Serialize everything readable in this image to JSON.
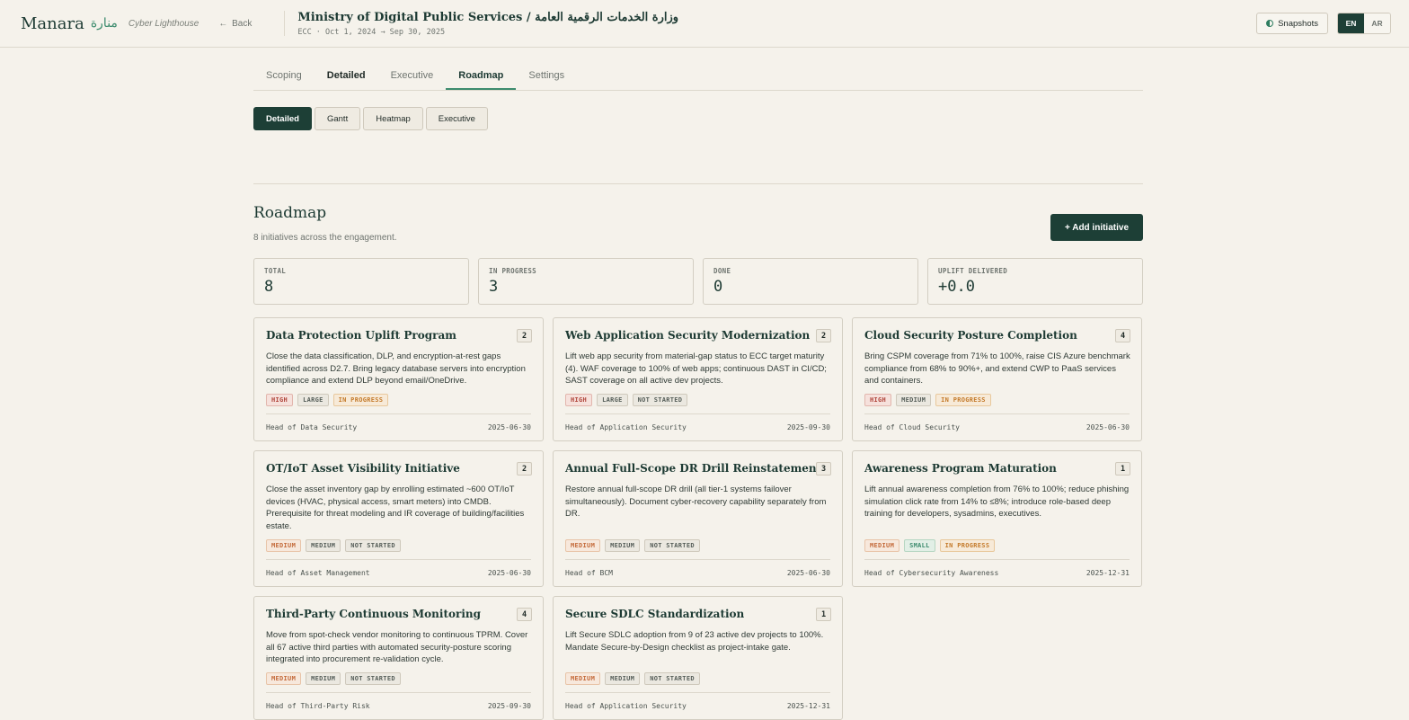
{
  "header": {
    "brand": "Manara",
    "brand_ar": "منارة",
    "tagline": "Cyber Lighthouse",
    "back_label": "Back",
    "ministry_title": "Ministry of Digital Public Services / وزارة الخدمات الرقمية العامة",
    "ministry_sub": "ECC · Oct 1, 2024 → Sep 30, 2025",
    "snapshots_label": "Snapshots",
    "lang_en": "EN",
    "lang_ar": "AR"
  },
  "tabs": [
    "Scoping",
    "Detailed",
    "Executive",
    "Roadmap",
    "Settings"
  ],
  "subtabs": [
    "Detailed",
    "Gantt",
    "Heatmap",
    "Executive"
  ],
  "roadmap": {
    "title": "Roadmap",
    "subtitle": "8 initiatives across the engagement.",
    "add_label": "+ Add initiative"
  },
  "stats": [
    {
      "label": "TOTAL",
      "value": "8"
    },
    {
      "label": "IN PROGRESS",
      "value": "3"
    },
    {
      "label": "DONE",
      "value": "0"
    },
    {
      "label": "UPLIFT DELIVERED",
      "value": "+0.0"
    }
  ],
  "cards": [
    {
      "title": "Data Protection Uplift Program",
      "count": "2",
      "desc": "Close the data classification, DLP, and encryption-at-rest gaps identified across D2.7. Bring legacy database servers into encryption compliance and extend DLP beyond email/OneDrive.",
      "priority": "HIGH",
      "size": "LARGE",
      "status": "IN PROGRESS",
      "owner": "Head of Data Security",
      "date": "2025-06-30"
    },
    {
      "title": "Web Application Security Modernization",
      "count": "2",
      "desc": "Lift web app security from material-gap status to ECC target maturity (4). WAF coverage to 100% of web apps; continuous DAST in CI/CD; SAST coverage on all active dev projects.",
      "priority": "HIGH",
      "size": "LARGE",
      "status": "NOT STARTED",
      "owner": "Head of Application Security",
      "date": "2025-09-30"
    },
    {
      "title": "Cloud Security Posture Completion",
      "count": "4",
      "desc": "Bring CSPM coverage from 71% to 100%, raise CIS Azure benchmark compliance from 68% to 90%+, and extend CWP to PaaS services and containers.",
      "priority": "HIGH",
      "size": "MEDIUM",
      "status": "IN PROGRESS",
      "owner": "Head of Cloud Security",
      "date": "2025-06-30"
    },
    {
      "title": "OT/IoT Asset Visibility Initiative",
      "count": "2",
      "desc": "Close the asset inventory gap by enrolling estimated ~600 OT/IoT devices (HVAC, physical access, smart meters) into CMDB. Prerequisite for threat modeling and IR coverage of building/facilities estate.",
      "priority": "MEDIUM",
      "size": "MEDIUM",
      "status": "NOT STARTED",
      "owner": "Head of Asset Management",
      "date": "2025-06-30"
    },
    {
      "title": "Annual Full-Scope DR Drill Reinstatement",
      "count": "3",
      "desc": "Restore annual full-scope DR drill (all tier-1 systems failover simultaneously). Document cyber-recovery capability separately from DR.",
      "priority": "MEDIUM",
      "size": "MEDIUM",
      "status": "NOT STARTED",
      "owner": "Head of BCM",
      "date": "2025-06-30"
    },
    {
      "title": "Awareness Program Maturation",
      "count": "1",
      "desc": "Lift annual awareness completion from 76% to 100%; reduce phishing simulation click rate from 14% to ≤8%; introduce role-based deep training for developers, sysadmins, executives.",
      "priority": "MEDIUM",
      "size": "SMALL",
      "status": "IN PROGRESS",
      "owner": "Head of Cybersecurity Awareness",
      "date": "2025-12-31"
    },
    {
      "title": "Third-Party Continuous Monitoring",
      "count": "4",
      "desc": "Move from spot-check vendor monitoring to continuous TPRM. Cover all 67 active third parties with automated security-posture scoring integrated into procurement re-validation cycle.",
      "priority": "MEDIUM",
      "size": "MEDIUM",
      "status": "NOT STARTED",
      "owner": "Head of Third-Party Risk",
      "date": "2025-09-30"
    },
    {
      "title": "Secure SDLC Standardization",
      "count": "1",
      "desc": "Lift Secure SDLC adoption from 9 of 23 active dev projects to 100%. Mandate Secure-by-Design checklist as project-intake gate.",
      "priority": "MEDIUM",
      "size": "MEDIUM",
      "status": "NOT STARTED",
      "owner": "Head of Application Security",
      "date": "2025-12-31"
    }
  ],
  "colors": {
    "accent": "#1d3f36",
    "accent_green": "#3d8c6e",
    "background": "#f5f2eb"
  }
}
